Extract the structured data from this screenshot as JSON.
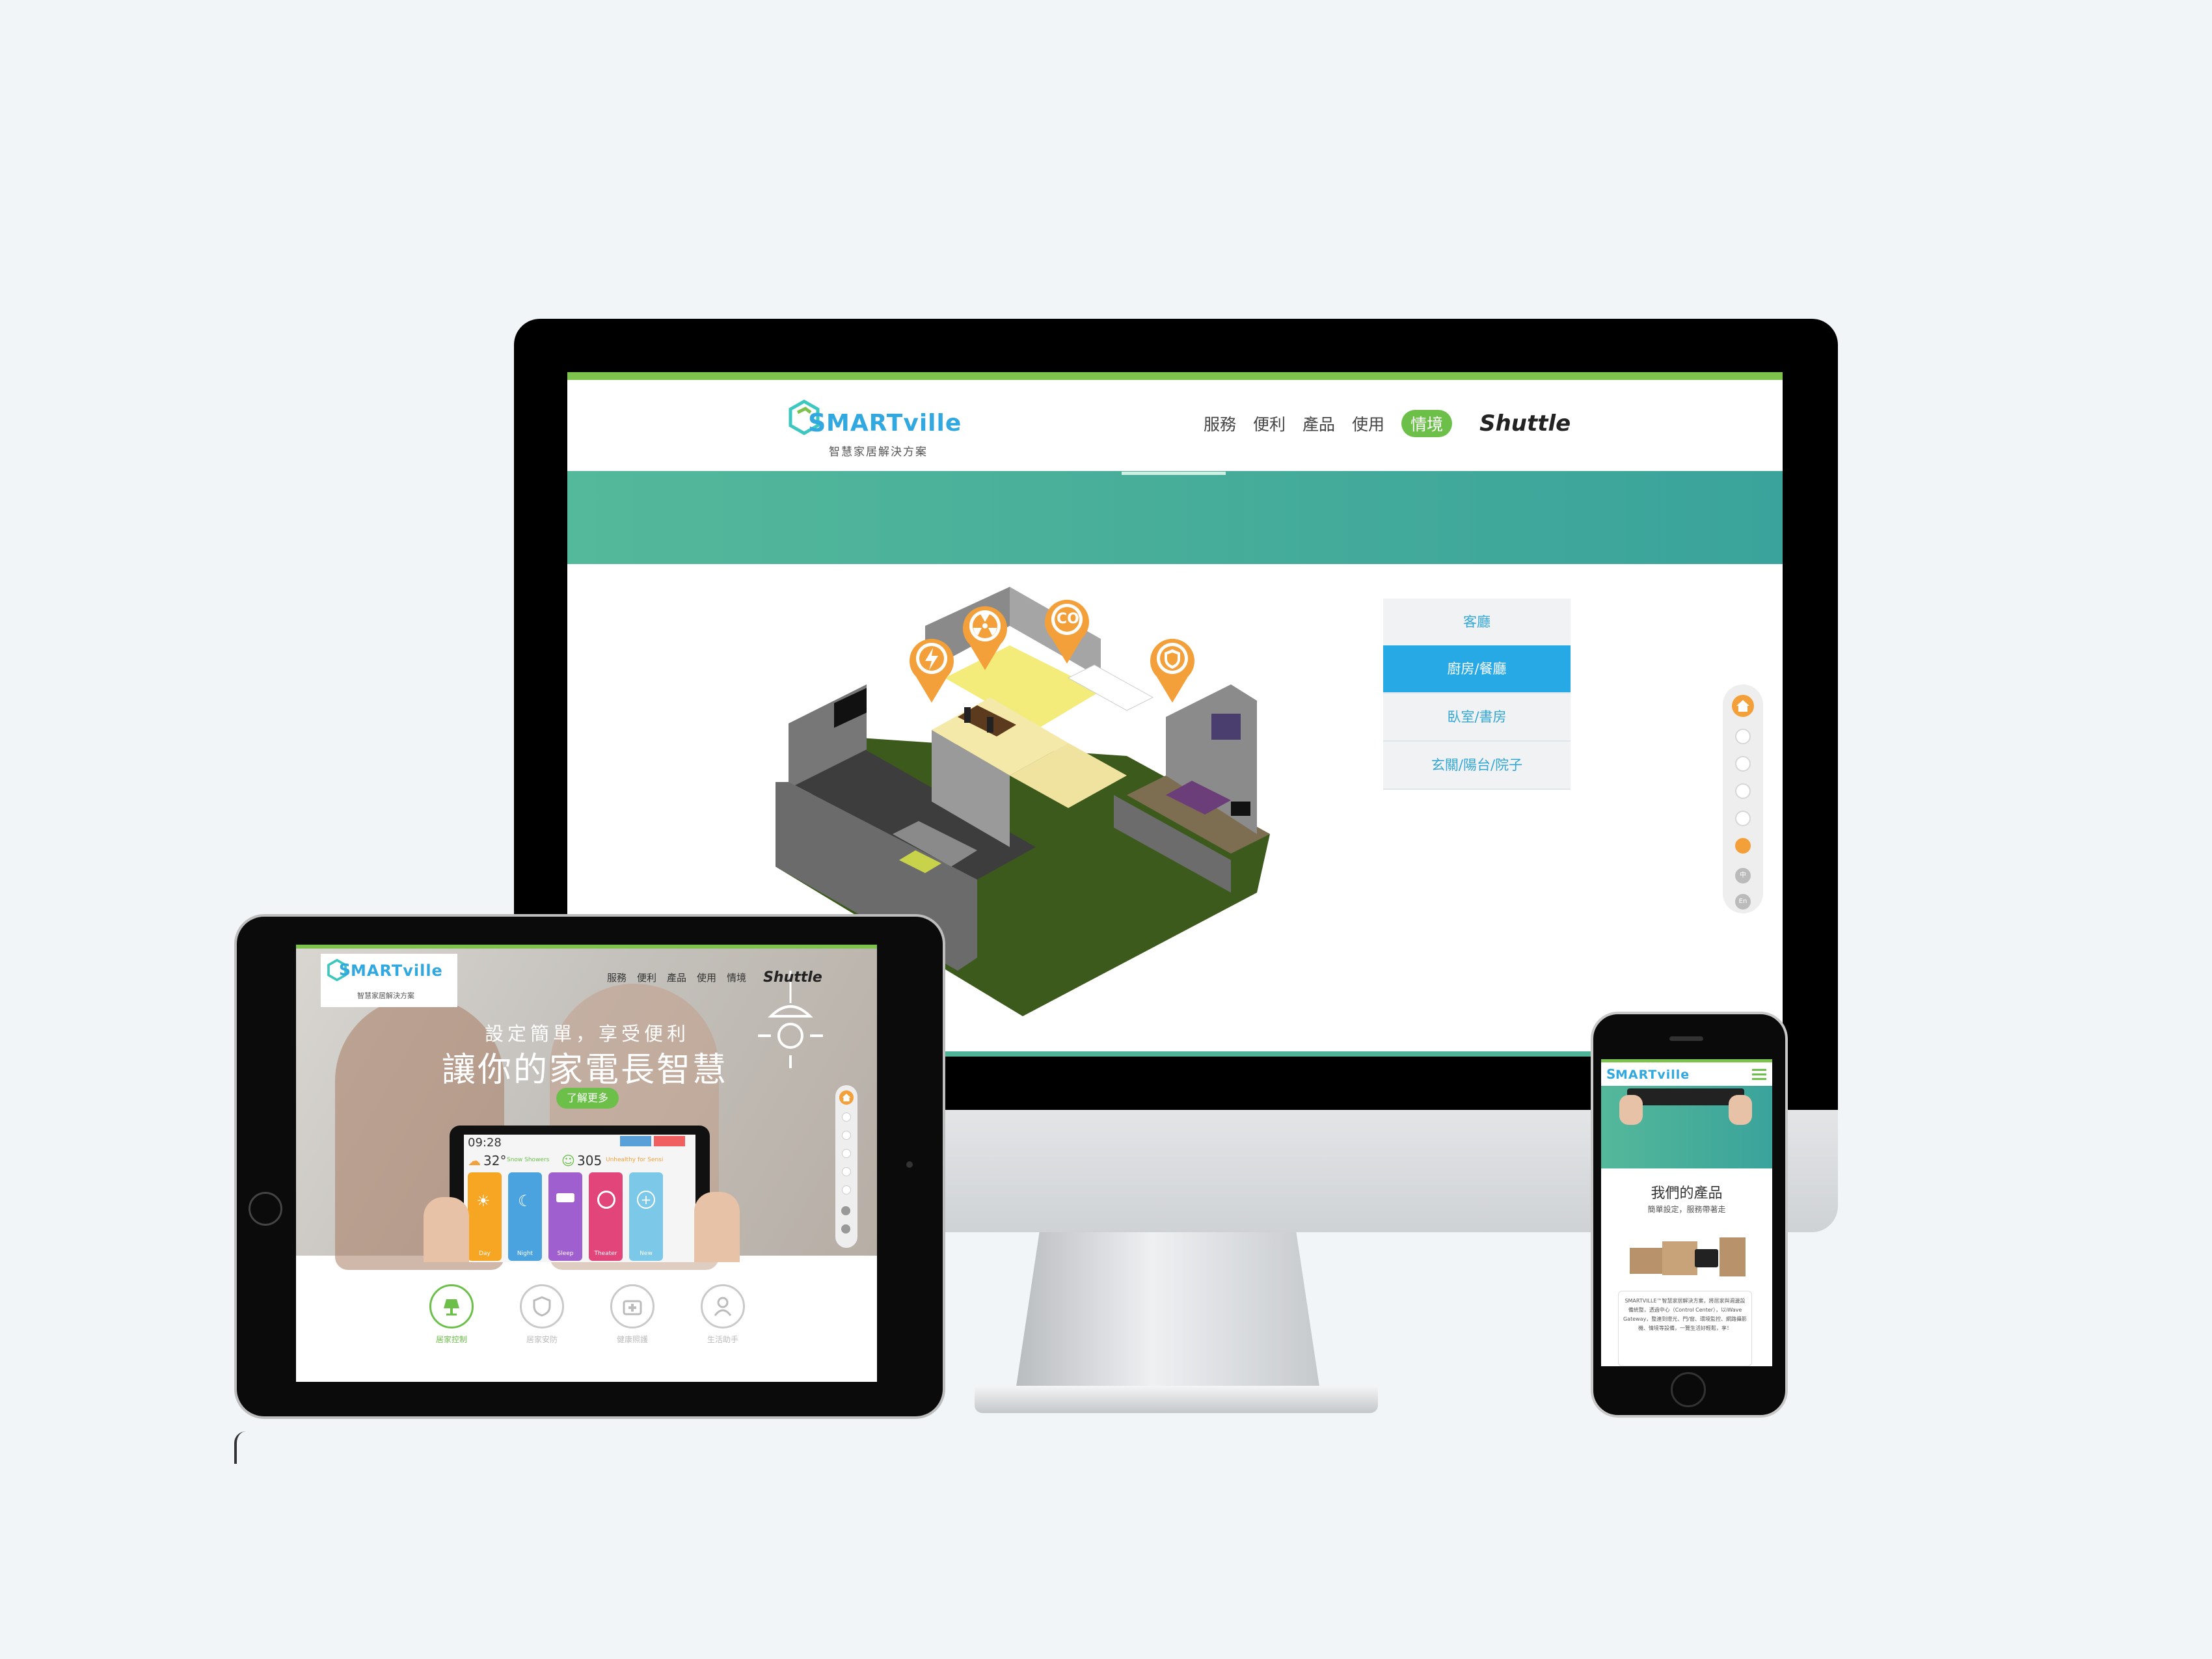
{
  "desktop": {
    "logo": {
      "main": "MARTville",
      "initial": "S",
      "tagline": "智慧家居解決方案"
    },
    "nav": [
      "服務",
      "便利",
      "產品",
      "使用",
      "情境"
    ],
    "nav_active": "情境",
    "brand": "Shuttle",
    "rooms": [
      "客廳",
      "廚房/餐廳",
      "臥室/書房",
      "玄關/陽台/院子"
    ],
    "active_room": "廚房/餐廳",
    "map_pins": [
      {
        "icon": "lightning-icon"
      },
      {
        "icon": "radiation-icon"
      },
      {
        "label": "CO"
      },
      {
        "icon": "shield-icon"
      }
    ],
    "pager_lang": [
      "中",
      "En"
    ]
  },
  "tablet": {
    "logo": {
      "main": "MARTville",
      "initial": "S",
      "tagline": "智慧家居解決方案"
    },
    "nav": [
      "服務",
      "便利",
      "產品",
      "使用",
      "情境"
    ],
    "brand": "Shuttle",
    "hero_subtitle": "設定簡單，享受便利",
    "hero_title": "讓你的家電長智慧",
    "hero_button": "了解更多",
    "device": {
      "time": "09:28",
      "weather_temp": "32°",
      "weather_desc": "Snow Showers",
      "air_value": "305",
      "air_desc": "Unhealthy for Sensi",
      "tiles": [
        {
          "label": "Day",
          "color": "#f6a623"
        },
        {
          "label": "Night",
          "color": "#4aa3df"
        },
        {
          "label": "Sleep",
          "color": "#a05fcf"
        },
        {
          "label": "Theater",
          "color": "#e2457a"
        },
        {
          "label": "New",
          "color": "#7cc8e8"
        }
      ]
    },
    "features": [
      {
        "label": "居家控制",
        "icon": "lamp-icon"
      },
      {
        "label": "居家安防",
        "icon": "shield-icon"
      },
      {
        "label": "健康照護",
        "icon": "medical-kit-icon"
      },
      {
        "label": "生活助手",
        "icon": "person-icon"
      }
    ]
  },
  "phone": {
    "logo": {
      "main": "MARTville",
      "initial": "S"
    },
    "section_title": "我們的產品",
    "section_subtitle": "簡單設定，服務帶著走",
    "body_text": "SMARTVILLE™智慧家居解決方案，將居家與週邊設備統整，透過中心（Control Center），以iWave Gateway，整連到燈光、門/窗、環境監控、網路攝影機、情境等設備，一覽生活好輕鬆，享！"
  }
}
